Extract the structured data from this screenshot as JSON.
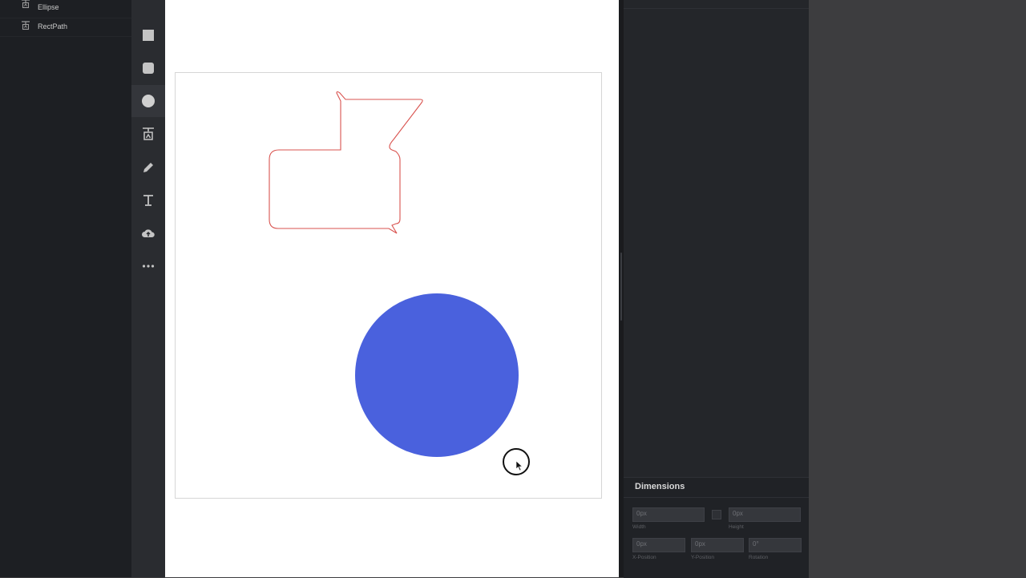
{
  "layers": {
    "items": [
      {
        "label": "Ellipse",
        "icon": "text-path-icon"
      },
      {
        "label": "RectPath",
        "icon": "text-path-icon"
      }
    ]
  },
  "toolbar": {
    "tools": [
      {
        "name": "rectangle-tool",
        "icon": "square-icon"
      },
      {
        "name": "rounded-rectangle-tool",
        "icon": "rounded-square-icon"
      },
      {
        "name": "ellipse-tool",
        "icon": "circle-icon",
        "active": true
      },
      {
        "name": "text-path-tool",
        "icon": "text-path-icon"
      },
      {
        "name": "pen-tool",
        "icon": "pencil-icon"
      },
      {
        "name": "text-tool",
        "icon": "text-icon"
      },
      {
        "name": "upload-tool",
        "icon": "cloud-upload-icon"
      },
      {
        "name": "more-tools",
        "icon": "more-dots-icon"
      }
    ]
  },
  "canvas": {
    "shapes": [
      {
        "name": "rect-path-shape",
        "fill": "none",
        "stroke": "#d9534f"
      },
      {
        "name": "ellipse-shape",
        "fill": "#4a61dd",
        "stroke": "none"
      }
    ]
  },
  "dimensions": {
    "title": "Dimensions",
    "width_value": "0px",
    "width_label": "Width",
    "height_value": "0px",
    "height_label": "Height",
    "x_value": "0px",
    "x_label": "X-Position",
    "y_value": "0px",
    "y_label": "Y-Position",
    "rotation_value": "0°",
    "rotation_label": "Rotation"
  },
  "colors": {
    "panel_bg": "#1d1f23",
    "toolbar_bg": "#2a2c30",
    "ellipse_fill": "#4a61dd",
    "path_stroke": "#d9534f"
  }
}
